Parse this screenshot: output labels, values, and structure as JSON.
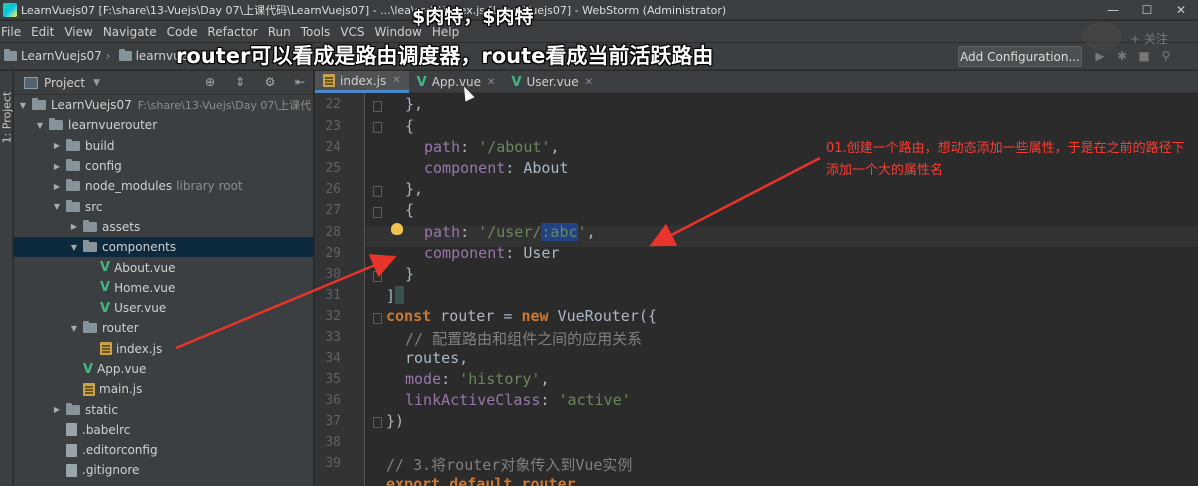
{
  "window": {
    "title": "LearnVuejs07 [F:\\share\\13-Vuejs\\Day 07\\上课代码\\LearnVuejs07] - ...\\lea\\src\\r\\index.js [LearnVuejs07] - WebStorm (Administrator)"
  },
  "menu": [
    "File",
    "Edit",
    "View",
    "Navigate",
    "Code",
    "Refactor",
    "Run",
    "Tools",
    "VCS",
    "Window",
    "Help"
  ],
  "breadcrumbs": [
    "LearnVuejs07",
    "learnvuer"
  ],
  "run_config_label": "Add Configuration...",
  "overlay": {
    "caption_top": "$肉特，$肉特",
    "caption_main": "router可以看成是路由调度器，route看成当前活跃路由",
    "annotation": "01.创建一个路由，想动态添加一些属性，于是在之前的路径下添加一个大的属性名",
    "watermark": "+ 关注"
  },
  "project_panel": {
    "title": "Project",
    "stripe_label": "1: Project",
    "tree": [
      {
        "label": "LearnVuejs07",
        "indent": 0,
        "kind": "folder",
        "open": true,
        "muted": "F:\\share\\13-Vuejs\\Day 07\\上课代"
      },
      {
        "label": "learnvuerouter",
        "indent": 1,
        "kind": "folder",
        "open": true
      },
      {
        "label": "build",
        "indent": 2,
        "kind": "folder",
        "open": false
      },
      {
        "label": "config",
        "indent": 2,
        "kind": "folder",
        "open": false
      },
      {
        "label": "node_modules",
        "indent": 2,
        "kind": "folder",
        "open": false,
        "muted": "library root"
      },
      {
        "label": "src",
        "indent": 2,
        "kind": "folder",
        "open": true
      },
      {
        "label": "assets",
        "indent": 3,
        "kind": "folder",
        "open": false
      },
      {
        "label": "components",
        "indent": 3,
        "kind": "folder",
        "open": true,
        "selected": true
      },
      {
        "label": "About.vue",
        "indent": 4,
        "kind": "vue"
      },
      {
        "label": "Home.vue",
        "indent": 4,
        "kind": "vue"
      },
      {
        "label": "User.vue",
        "indent": 4,
        "kind": "vue"
      },
      {
        "label": "router",
        "indent": 3,
        "kind": "folder",
        "open": true
      },
      {
        "label": "index.js",
        "indent": 4,
        "kind": "js"
      },
      {
        "label": "App.vue",
        "indent": 3,
        "kind": "vue"
      },
      {
        "label": "main.js",
        "indent": 3,
        "kind": "js"
      },
      {
        "label": "static",
        "indent": 2,
        "kind": "folder",
        "open": false
      },
      {
        "label": ".babelrc",
        "indent": 2,
        "kind": "file"
      },
      {
        "label": ".editorconfig",
        "indent": 2,
        "kind": "file"
      },
      {
        "label": ".gitignore",
        "indent": 2,
        "kind": "file"
      }
    ]
  },
  "editor": {
    "tabs": [
      {
        "label": "index.js",
        "kind": "js",
        "active": true
      },
      {
        "label": "App.vue",
        "kind": "vue",
        "active": false
      },
      {
        "label": "User.vue",
        "kind": "vue",
        "active": false
      }
    ],
    "line_numbers": [
      "22",
      "23",
      "24",
      "25",
      "26",
      "27",
      "28",
      "29",
      "30",
      "31",
      "32",
      "33",
      "34",
      "35",
      "36",
      "37",
      "38",
      "39"
    ],
    "code": {
      "l22": "},",
      "l23": "{",
      "l24_key": "path",
      "l24_val": "'/about'",
      "l25_key": "component",
      "l25_val": "About",
      "l26": "},",
      "l27": "{",
      "l28_key": "path",
      "l28_val_a": "'/user/",
      "l28_val_sel": ":abc",
      "l28_val_b": "'",
      "l29_key": "component",
      "l29_val": "User",
      "l30": "}",
      "l31": "]",
      "l32_kw": "const",
      "l32_a": " router = ",
      "l32_new": "new",
      "l32_b": " VueRouter({",
      "l33": "// 配置路由和组件之间的应用关系",
      "l34": "routes,",
      "l35_key": "mode",
      "l35_val": "'history'",
      "l36_key": "linkActiveClass",
      "l36_val": "'active'",
      "l37": "})",
      "l39": "// 3.将router对象传入到Vue实例",
      "l40": "export default router"
    }
  },
  "colors": {
    "keyword": "#cc7832",
    "string": "#6a8759",
    "comment": "#808080",
    "annotation": "#ff3b30",
    "selection": "#214283"
  }
}
